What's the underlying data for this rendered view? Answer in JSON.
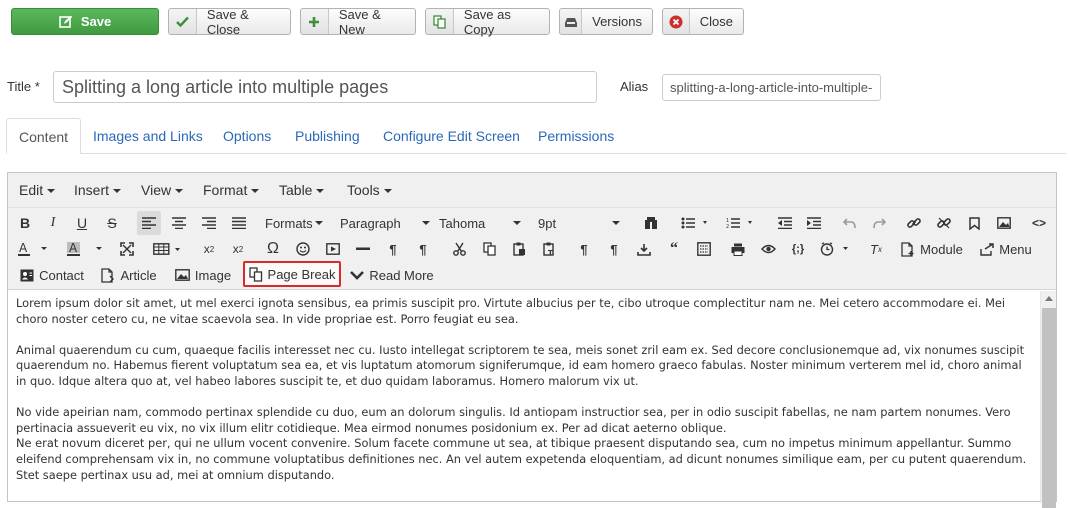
{
  "toolbar": {
    "save": "Save",
    "save_close": "Save & Close",
    "save_new": "Save & New",
    "save_copy": "Save as Copy",
    "versions": "Versions",
    "close": "Close"
  },
  "form": {
    "title_label": "Title *",
    "title_value": "Splitting a long article into multiple pages",
    "alias_label": "Alias",
    "alias_value": "splitting-a-long-article-into-multiple-pages"
  },
  "tabs": [
    "Content",
    "Images and Links",
    "Options",
    "Publishing",
    "Configure Edit Screen",
    "Permissions"
  ],
  "editor": {
    "menus": [
      "Edit",
      "Insert",
      "View",
      "Format",
      "Table",
      "Tools"
    ],
    "formats": "Formats",
    "block": "Paragraph",
    "font": "Tahoma",
    "size": "9pt",
    "module_btn": "Module",
    "menu_btn": "Menu",
    "contact_btn": "Contact",
    "article_btn": "Article",
    "image_btn": "Image",
    "pagebreak_btn": "Page Break",
    "readmore_btn": "Read More",
    "highlight_color": "#d9292b"
  },
  "content": {
    "p1": "Lorem ipsum dolor sit amet, ut mel exerci ignota sensibus, ea primis suscipit pro. Virtute albucius per te, cibo utroque complectitur nam ne. Mei cetero accommodare ei. Mei choro noster cetero cu, ne vitae scaevola sea. In vide propriae est. Porro feugiat eu sea.",
    "p2": "Animal quaerendum cu cum, quaeque facilis interesset nec cu. Iusto intellegat scriptorem te sea, meis sonet zril eam ex. Sed decore conclusionemque ad, vix nonumes suscipit quaerendum no. Habemus fierent voluptatum sea ea, et vis luptatum atomorum signiferumque, id eam homero graeco fabulas. Noster minimum verterem mel id, choro animal in quo. Idque altera quo at, vel habeo labores suscipit te, et duo quidam laboramus. Homero malorum vix ut.",
    "p3": "No vide apeirian nam, commodo pertinax splendide cu duo, eum an dolorum singulis. Id antiopam instructior sea, per in odio suscipit fabellas, ne nam partem nonumes. Vero pertinacia assueverit eu vix, no vix illum elitr cotidieque. Mea eirmod nonumes posidonium ex. Per ad dicat aeterno oblique.",
    "p4": "Ne erat novum diceret per, qui ne ullum vocent convenire. Solum facete commune ut sea, at tibique praesent disputando sea, cum no impetus minimum appellantur. Summo eleifend comprehensam vix in, no commune voluptatibus definitiones nec. An vel autem expetenda eloquentiam, ad dicunt nonumes similique eam, per cu putent quaerendum. Stet saepe pertinax usu ad, mei at omnium disputando."
  },
  "colors": {
    "accent": "#2a69b8",
    "save_green": "#4cae4c",
    "close_red": "#c9302c"
  }
}
